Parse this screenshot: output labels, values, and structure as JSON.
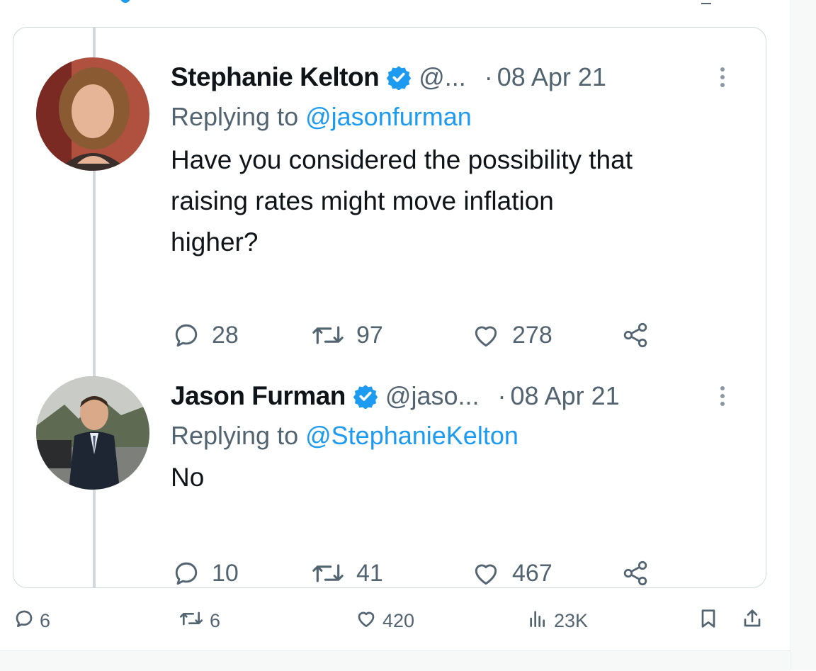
{
  "tweets": [
    {
      "name": "Stephanie Kelton",
      "handle": "@...",
      "dot": "·",
      "date": "08 Apr 21",
      "replying_prefix": "Replying to ",
      "replying_to": "@jasonfurman",
      "text_lines": [
        "Have you considered the possibility that",
        "raising rates might move inflation",
        "higher?"
      ],
      "replies": "28",
      "retweets": "97",
      "likes": "278"
    },
    {
      "name": "Jason Furman",
      "handle": "@jaso...",
      "dot": "·",
      "date": "08 Apr 21",
      "replying_prefix": "Replying to ",
      "replying_to": "@StephanieKelton",
      "text_lines": [
        "No"
      ],
      "replies": "10",
      "retweets": "41",
      "likes": "467"
    }
  ],
  "footer": {
    "replies": "6",
    "retweets": "6",
    "likes": "420",
    "views": "23K"
  },
  "colors": {
    "accent": "#1d9bf0",
    "secondary_text": "#536471",
    "border": "#cfd9de"
  },
  "icons": [
    "verified-badge-icon",
    "more-icon",
    "reply-icon",
    "retweet-icon",
    "like-icon",
    "share-icon",
    "views-icon",
    "bookmark-icon",
    "upload-icon"
  ]
}
